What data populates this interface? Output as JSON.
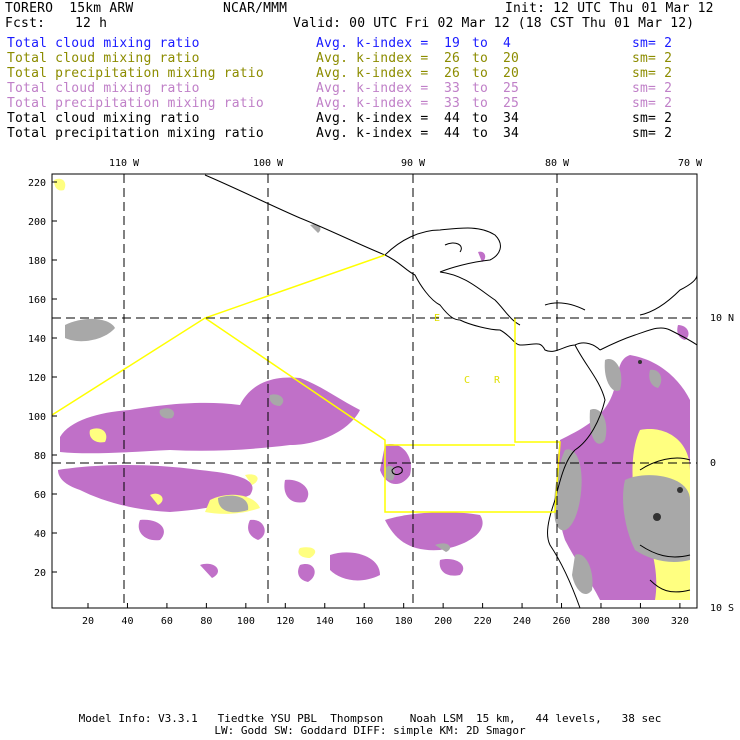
{
  "header": {
    "model": "TORERO  15km ARW",
    "org": "NCAR/MMM",
    "init": "Init: 12 UTC Thu 01 Mar 12",
    "fcst_label": "Fcst:",
    "fcst_value": "12 h",
    "valid": "Valid: 00 UTC Fri 02 Mar 12 (18 CST Thu 01 Mar 12)"
  },
  "fields": [
    {
      "name": "Total cloud mixing ratio",
      "avg": "Avg. k-index =",
      "from": "19",
      "to_word": "to",
      "to": "4",
      "sm": "sm= 2",
      "color": "#1a1aff"
    },
    {
      "name": "Total cloud mixing ratio",
      "avg": "Avg. k-index =",
      "from": "26",
      "to_word": "to",
      "to": "20",
      "sm": "sm= 2",
      "color": "#8c8c00"
    },
    {
      "name": "Total precipitation mixing ratio",
      "avg": "Avg. k-index =",
      "from": "26",
      "to_word": "to",
      "to": "20",
      "sm": "sm= 2",
      "color": "#8c8c00"
    },
    {
      "name": "Total cloud mixing ratio",
      "avg": "Avg. k-index =",
      "from": "33",
      "to_word": "to",
      "to": "25",
      "sm": "sm= 2",
      "color": "#c080c8"
    },
    {
      "name": "Total precipitation mixing ratio",
      "avg": "Avg. k-index =",
      "from": "33",
      "to_word": "to",
      "to": "25",
      "sm": "sm= 2",
      "color": "#c080c8"
    },
    {
      "name": "Total cloud mixing ratio",
      "avg": "Avg. k-index =",
      "from": "44",
      "to_word": "to",
      "to": "34",
      "sm": "sm= 2",
      "color": "#000000"
    },
    {
      "name": "Total precipitation mixing ratio",
      "avg": "Avg. k-index =",
      "from": "44",
      "to_word": "to",
      "to": "34",
      "sm": "sm= 2",
      "color": "#000000"
    }
  ],
  "map": {
    "x_ticks": [
      "20",
      "40",
      "60",
      "80",
      "100",
      "120",
      "140",
      "160",
      "180",
      "200",
      "220",
      "240",
      "260",
      "280",
      "300",
      "320"
    ],
    "y_ticks": [
      "20",
      "40",
      "60",
      "80",
      "100",
      "120",
      "140",
      "160",
      "180",
      "200",
      "220"
    ],
    "lon_labels": [
      "110 W",
      "100 W",
      "90 W",
      "80 W",
      "70 W"
    ],
    "lat_labels": [
      "10 N",
      "0",
      "10 S"
    ],
    "region_labels": [
      "E",
      "C",
      "R"
    ],
    "colors": {
      "olive_field": "#ffff80",
      "pink_field": "#c070c8",
      "black_field": "#a0a0a0",
      "boundary": "#ffff00"
    }
  },
  "footer": {
    "line1": "Model Info: V3.3.1   Tiedtke YSU PBL  Thompson    Noah LSM  15 km,   44 levels,   38 sec",
    "line2": "LW: Godd SW: Goddard DIFF: simple KM: 2D Smagor"
  }
}
